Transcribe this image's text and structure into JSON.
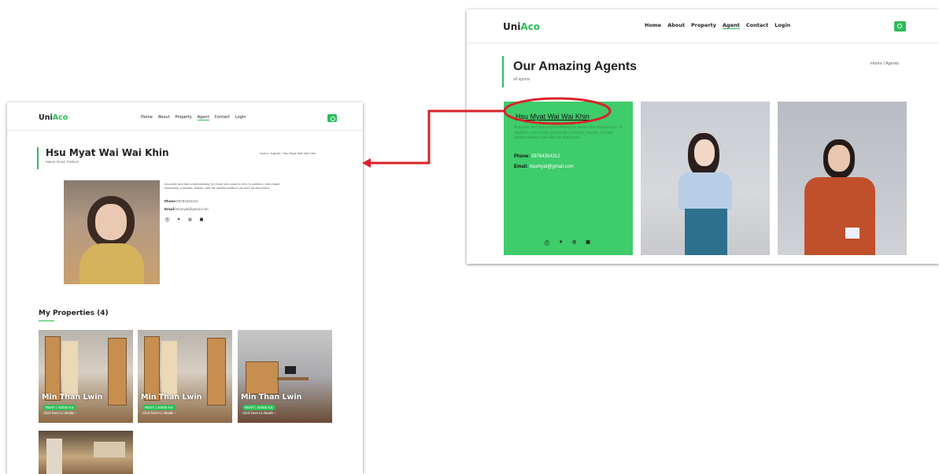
{
  "brand": {
    "part1": "Uni",
    "part2": "Aco"
  },
  "nav": [
    "Home",
    "About",
    "Property",
    "Agent",
    "Contact",
    "Login"
  ],
  "agent_detail": {
    "name": "Hsu Myat Wai Wai Khin",
    "location": "Maras Road, Pathein",
    "breadcrumb": "Home  /  Agents  /  Hsu Myat Wai Wai Khin",
    "bio": "Accurate and fast understanding for those who want to rent. In addition, real estate ownership contracts, leases, and tax related matters can also be discussed.",
    "phone_label": "Phone:",
    "phone": "09784354312",
    "email_label": "Email:",
    "email": "hsumyat@gmail.com",
    "properties_heading": "My Properties (4)",
    "properties": [
      {
        "name": "Min Than Lwin",
        "badge": "RENT | 40000 KS",
        "link": "Click here to details  ›"
      },
      {
        "name": "Min Than Lwin",
        "badge": "RENT | 40000 KS",
        "link": "Click here to details  ›"
      },
      {
        "name": "Min Than Lwin",
        "badge": "RENT | 40000 KS",
        "link": "Click here to details  ›"
      }
    ]
  },
  "agents_page": {
    "title": "Our Amazing Agents",
    "subtitle": "all agents",
    "breadcrumb": "Home  /  Agents",
    "card": {
      "name": "Hsu Myat Wai Wai Khin",
      "bio": "Accurate and fast understanding for those who want to rent. In addition, real estate ownership contracts, leases, and tax related matters can also be discussed.",
      "phone_label": "Phone:",
      "phone": "09784354312",
      "email_label": "Email:",
      "email": "hsumyat@gmail.com"
    }
  },
  "social_icons": [
    "facebook-icon",
    "twitter-icon",
    "instagram-icon",
    "linkedin-icon"
  ],
  "colors": {
    "accent": "#2ebd59",
    "highlight_circle": "#d9232a",
    "arrow": "#d9232a"
  }
}
